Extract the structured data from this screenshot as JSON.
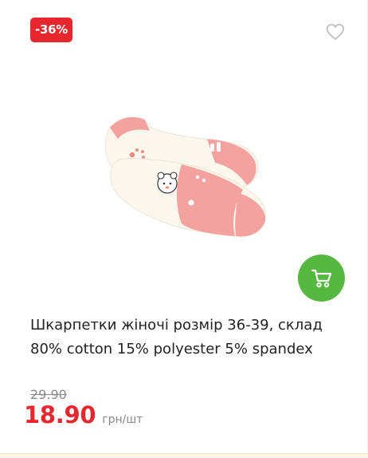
{
  "product": {
    "discount_badge": "-36%",
    "title": "Шкарпетки жіночі розмір 36-39, склад 80% cotton 15% polyester 5% spandex",
    "old_price": "29.90",
    "price": "18.90",
    "price_unit": "грн/шт",
    "image_alt": "socks"
  },
  "colors": {
    "badge": "#e8262e",
    "price": "#e8262e",
    "cart_button": "#55b83f",
    "sock_pink": "#f4a2a0",
    "sock_cream": "#fbf7ec"
  },
  "icons": {
    "favorite": "heart-outline-icon",
    "cart": "cart-icon"
  }
}
